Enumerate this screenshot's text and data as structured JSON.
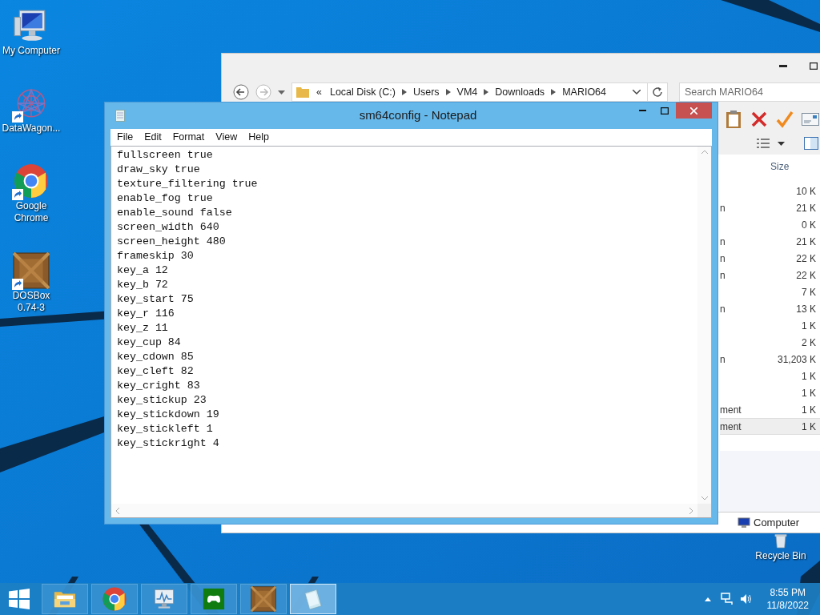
{
  "desktop_icons": [
    {
      "label": "My Computer",
      "kind": "computer",
      "shortcut": false
    },
    {
      "label": "DataWagon...",
      "kind": "datawagon",
      "shortcut": true
    },
    {
      "label": "Google Chrome",
      "kind": "chrome",
      "shortcut": true
    },
    {
      "label": "DOSBox 0.74-3",
      "kind": "dosbox",
      "shortcut": true
    }
  ],
  "recycle_bin": {
    "label": "Recycle Bin"
  },
  "explorer": {
    "breadcrumb": [
      "«",
      "Local Disk (C:)",
      "Users",
      "VM4",
      "Downloads",
      "MARIO64"
    ],
    "search": {
      "placeholder": "Search MARIO64"
    },
    "columns": [
      "Size"
    ],
    "rows": [
      {
        "size": "10 K",
        "selected": false
      },
      {
        "type": "n",
        "size": "21 K",
        "selected": false
      },
      {
        "size": "0 K",
        "selected": false
      },
      {
        "type": "n",
        "size": "21 K",
        "selected": false
      },
      {
        "type": "n",
        "size": "22 K",
        "selected": false
      },
      {
        "type": "n",
        "size": "22 K",
        "selected": false
      },
      {
        "size": "7 K",
        "selected": false
      },
      {
        "type": "n",
        "size": "13 K",
        "selected": false
      },
      {
        "size": "1 K",
        "selected": false
      },
      {
        "size": "2 K",
        "selected": false
      },
      {
        "type": "n",
        "size": "31,203 K",
        "selected": false
      },
      {
        "size": "1 K",
        "selected": false
      },
      {
        "size": "1 K",
        "selected": false
      },
      {
        "type": "ment",
        "size": "1 K",
        "selected": false
      },
      {
        "type": "ment",
        "size": "1 K",
        "selected": true
      }
    ],
    "nav_item": "Computer"
  },
  "notepad": {
    "title": "sm64config - Notepad",
    "menu": [
      "File",
      "Edit",
      "Format",
      "View",
      "Help"
    ],
    "lines": [
      "fullscreen true",
      "draw_sky true",
      "texture_filtering true",
      "enable_fog true",
      "enable_sound false",
      "screen_width 640",
      "screen_height 480",
      "frameskip 30",
      "key_a 12",
      "key_b 72",
      "key_start 75",
      "key_r 116",
      "key_z 11",
      "key_cup 84",
      "key_cdown 85",
      "key_cleft 82",
      "key_cright 83",
      "key_stickup 23",
      "key_stickdown 19",
      "key_stickleft 1",
      "key_stickright 4"
    ]
  },
  "taskbar": {
    "apps": [
      {
        "kind": "explorer",
        "active": false
      },
      {
        "kind": "chrome",
        "active": false
      },
      {
        "kind": "monitor",
        "active": false
      },
      {
        "kind": "gamepad",
        "active": false
      },
      {
        "kind": "dosbox",
        "active": false
      },
      {
        "kind": "notepad",
        "active": true
      }
    ],
    "clock": {
      "time": "8:55 PM",
      "date": "11/8/2022"
    }
  }
}
